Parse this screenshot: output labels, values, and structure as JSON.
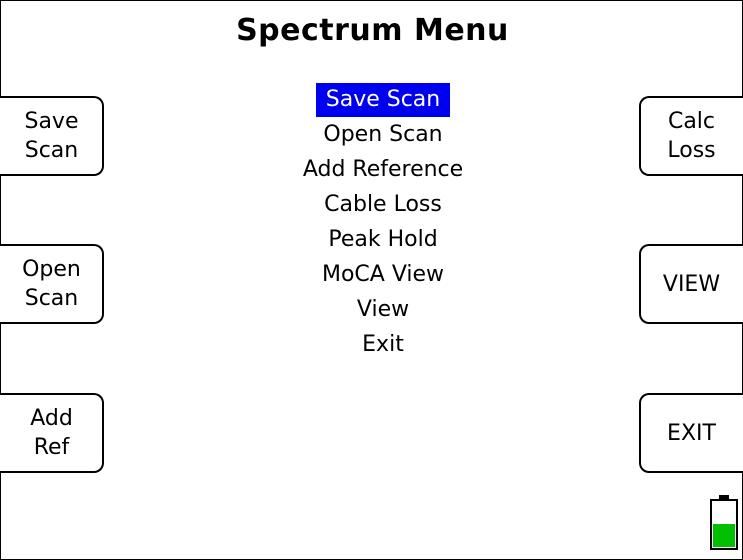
{
  "title": "Spectrum Menu",
  "softkeys": {
    "left": [
      "Save\nScan",
      "Open\nScan",
      "Add\nRef"
    ],
    "right": [
      "Calc\nLoss",
      "VIEW",
      "EXIT"
    ]
  },
  "menu": {
    "items": [
      "Save Scan",
      "Open Scan",
      "Add Reference",
      "Cable Loss",
      "Peak Hold",
      "MoCA View",
      "View",
      "Exit"
    ],
    "selected": "Save Scan"
  },
  "battery": {
    "icon": "battery-icon",
    "level": 0.5,
    "fill_color": "#00c000"
  },
  "colors": {
    "highlight": "#0000f0",
    "highlight_text": "#ffffff"
  }
}
